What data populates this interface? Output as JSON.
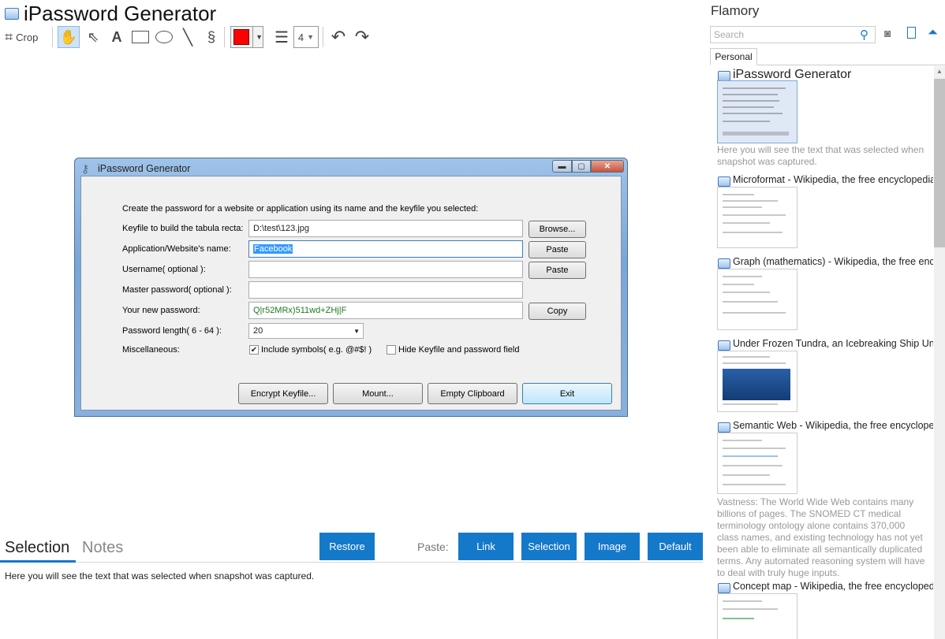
{
  "app": {
    "title": "iPassword Generator"
  },
  "toolbar": {
    "crop_label": "Crop",
    "line_width": "4",
    "color": "#ff0000"
  },
  "screenshot": {
    "window_title": "iPassword Generator",
    "intro": "Create the password for a website or application using its name and the keyfile you selected:",
    "keyfile_label": "Keyfile to build the tabula recta:",
    "keyfile_value": "D:\\test\\123.jpg",
    "browse": "Browse...",
    "app_label": "Application/Website's name:",
    "app_value": "Facebook",
    "paste1": "Paste",
    "username_label": "Username( optional ):",
    "paste2": "Paste",
    "master_label": "Master password( optional ):",
    "newpw_label": "Your new password:",
    "newpw_value": "Q|r52MRx)511wd+ZHj|F",
    "copy": "Copy",
    "length_label": "Password length( 6 - 64 ):",
    "length_value": "20",
    "misc_label": "Miscellaneous:",
    "include_symbols": "Include symbols( e.g. @#$! )",
    "hide_keyfile": "Hide Keyfile and password field",
    "encrypt": "Encrypt Keyfile...",
    "mount": "Mount...",
    "empty_clipboard": "Empty Clipboard",
    "exit": "Exit"
  },
  "bottom": {
    "tab_selection": "Selection",
    "tab_notes": "Notes",
    "restore": "Restore",
    "paste_label": "Paste:",
    "link": "Link",
    "selection": "Selection",
    "image": "Image",
    "default": "Default",
    "selection_text": "Here you will see the text that was selected when snapshot was captured."
  },
  "sidebar": {
    "title": "Flamory",
    "search_placeholder": "Search",
    "tab_personal": "Personal",
    "items": [
      {
        "title": "iPassword Generator",
        "desc": "Here you will see the text that was selected when snapshot was captured."
      },
      {
        "title": "Microformat - Wikipedia, the free encyclopedia",
        "desc": ""
      },
      {
        "title": "Graph (mathematics) - Wikipedia, the free encyclopedia",
        "desc": ""
      },
      {
        "title": "Under Frozen Tundra, an Icebreaking Ship Uncovers",
        "desc": ""
      },
      {
        "title": "Semantic Web - Wikipedia, the free encyclopedia",
        "desc": "Vastness: The World Wide Web contains many billions of pages. The SNOMED CT medical terminology ontology alone contains 370,000 class names, and existing technology has not yet been able to eliminate all semantically duplicated terms. Any automated reasoning system will have to deal with truly huge inputs."
      },
      {
        "title": "Concept map - Wikipedia, the free encyclopedia",
        "desc": ""
      }
    ]
  }
}
